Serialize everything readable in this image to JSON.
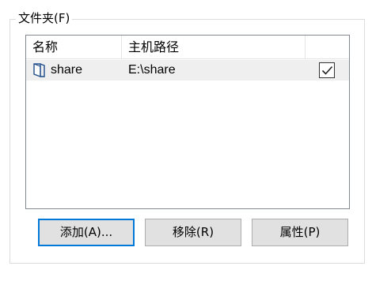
{
  "group": {
    "title": "文件夹(F)"
  },
  "listview": {
    "columns": [
      "名称",
      "主机路径",
      ""
    ],
    "rows": [
      {
        "name": "share",
        "path": "E:\\share",
        "checked": true,
        "icon": "shared-folder-icon"
      }
    ]
  },
  "buttons": {
    "add": "添加(A)...",
    "remove": "移除(R)",
    "properties": "属性(P)"
  },
  "colors": {
    "focus_border": "#0078d7",
    "row_highlight": "#efefef",
    "button_face": "#e1e1e1"
  }
}
